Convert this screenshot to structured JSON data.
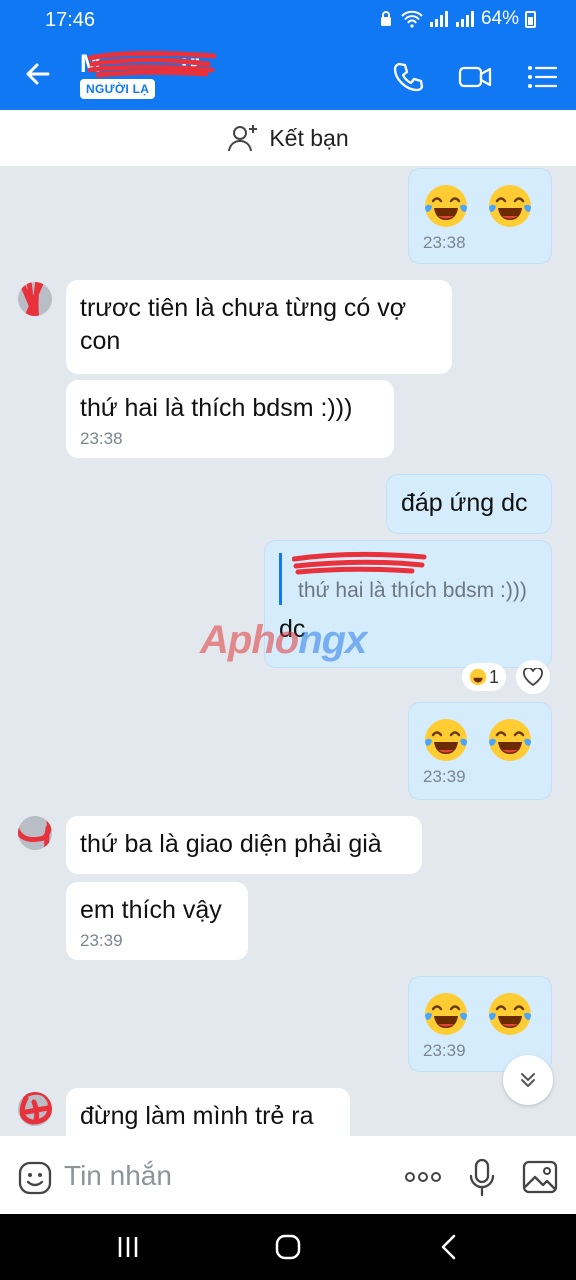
{
  "status_bar": {
    "time": "17:46",
    "battery": "64%"
  },
  "header": {
    "contact_name": "M",
    "contact_name_tail": "ư",
    "badge": "NGƯỜI LẠ"
  },
  "friend_bar": {
    "label": "Kết bạn"
  },
  "messages": {
    "m1": {
      "time": "23:38"
    },
    "m2": {
      "text": "trươc tiên là chưa từng có vợ con"
    },
    "m3": {
      "text": "thứ hai là thích bdsm :)))",
      "time": "23:38"
    },
    "m4": {
      "text": "đáp ứng dc"
    },
    "m5": {
      "quote_text": "thứ hai là thích bdsm :)))",
      "text": "dc",
      "reaction_count": "1"
    },
    "m6": {
      "time": "23:39"
    },
    "m7": {
      "text": "thứ ba là giao diện phải già"
    },
    "m8": {
      "text": "em thích vậy",
      "time": "23:39"
    },
    "m9": {
      "time": "23:39"
    },
    "m10": {
      "text": "đừng làm mình trẻ ra"
    }
  },
  "watermark": {
    "part1": "Apho",
    "part2": "ngx"
  },
  "input": {
    "placeholder": "Tin nhắn"
  },
  "colors": {
    "brand": "#0f78f2",
    "outgoing_bubble": "#d5ecfc",
    "chat_bg": "#e3e8ee"
  },
  "icons": [
    "back-arrow-icon",
    "phone-icon",
    "video-call-icon",
    "menu-icon",
    "add-friend-icon",
    "laughing-emoji-icon",
    "heart-icon",
    "chevron-down-icon",
    "sticker-icon",
    "more-icon",
    "microphone-icon",
    "image-icon"
  ]
}
